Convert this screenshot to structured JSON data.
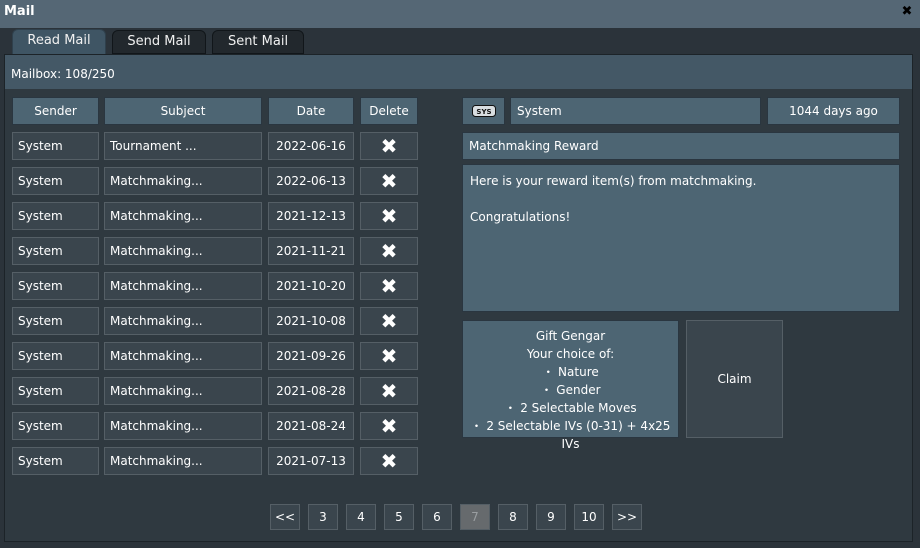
{
  "window": {
    "title": "Mail",
    "close_icon": "close-icon"
  },
  "tabs": [
    {
      "label": "Read Mail",
      "active": true
    },
    {
      "label": "Send Mail",
      "active": false
    },
    {
      "label": "Sent Mail",
      "active": false
    }
  ],
  "mailbox": {
    "count": "Mailbox: 108/250"
  },
  "table": {
    "headers": {
      "sender": "Sender",
      "subject": "Subject",
      "date": "Date",
      "delete": "Delete"
    },
    "rows": [
      {
        "sender": "System",
        "subject": "Tournament ...",
        "date": "2022-06-16"
      },
      {
        "sender": "System",
        "subject": "Matchmaking...",
        "date": "2022-06-13"
      },
      {
        "sender": "System",
        "subject": "Matchmaking...",
        "date": "2021-12-13"
      },
      {
        "sender": "System",
        "subject": "Matchmaking...",
        "date": "2021-11-21"
      },
      {
        "sender": "System",
        "subject": "Matchmaking...",
        "date": "2021-10-20"
      },
      {
        "sender": "System",
        "subject": "Matchmaking...",
        "date": "2021-10-08"
      },
      {
        "sender": "System",
        "subject": "Matchmaking...",
        "date": "2021-09-26"
      },
      {
        "sender": "System",
        "subject": "Matchmaking...",
        "date": "2021-08-28"
      },
      {
        "sender": "System",
        "subject": "Matchmaking...",
        "date": "2021-08-24"
      },
      {
        "sender": "System",
        "subject": "Matchmaking...",
        "date": "2021-07-13"
      }
    ],
    "delete_glyph": "✖"
  },
  "message": {
    "sender": "System",
    "age": "1044 days  ago",
    "subject": "Matchmaking Reward",
    "body_lines": [
      "Here is your reward item(s) from matchmaking.",
      "Congratulations!"
    ],
    "gift": {
      "title": "Gift Gengar",
      "subtitle": "Your choice of:",
      "options": [
        "・ Nature",
        "・ Gender",
        "・ 2 Selectable Moves",
        "・ 2 Selectable IVs (0-31) + 4x25 IVs"
      ]
    },
    "claim_label": "Claim"
  },
  "pagination": {
    "buttons": [
      "<<",
      "3",
      "4",
      "5",
      "6",
      "7",
      "8",
      "9",
      "10",
      ">>"
    ],
    "current": "7"
  }
}
